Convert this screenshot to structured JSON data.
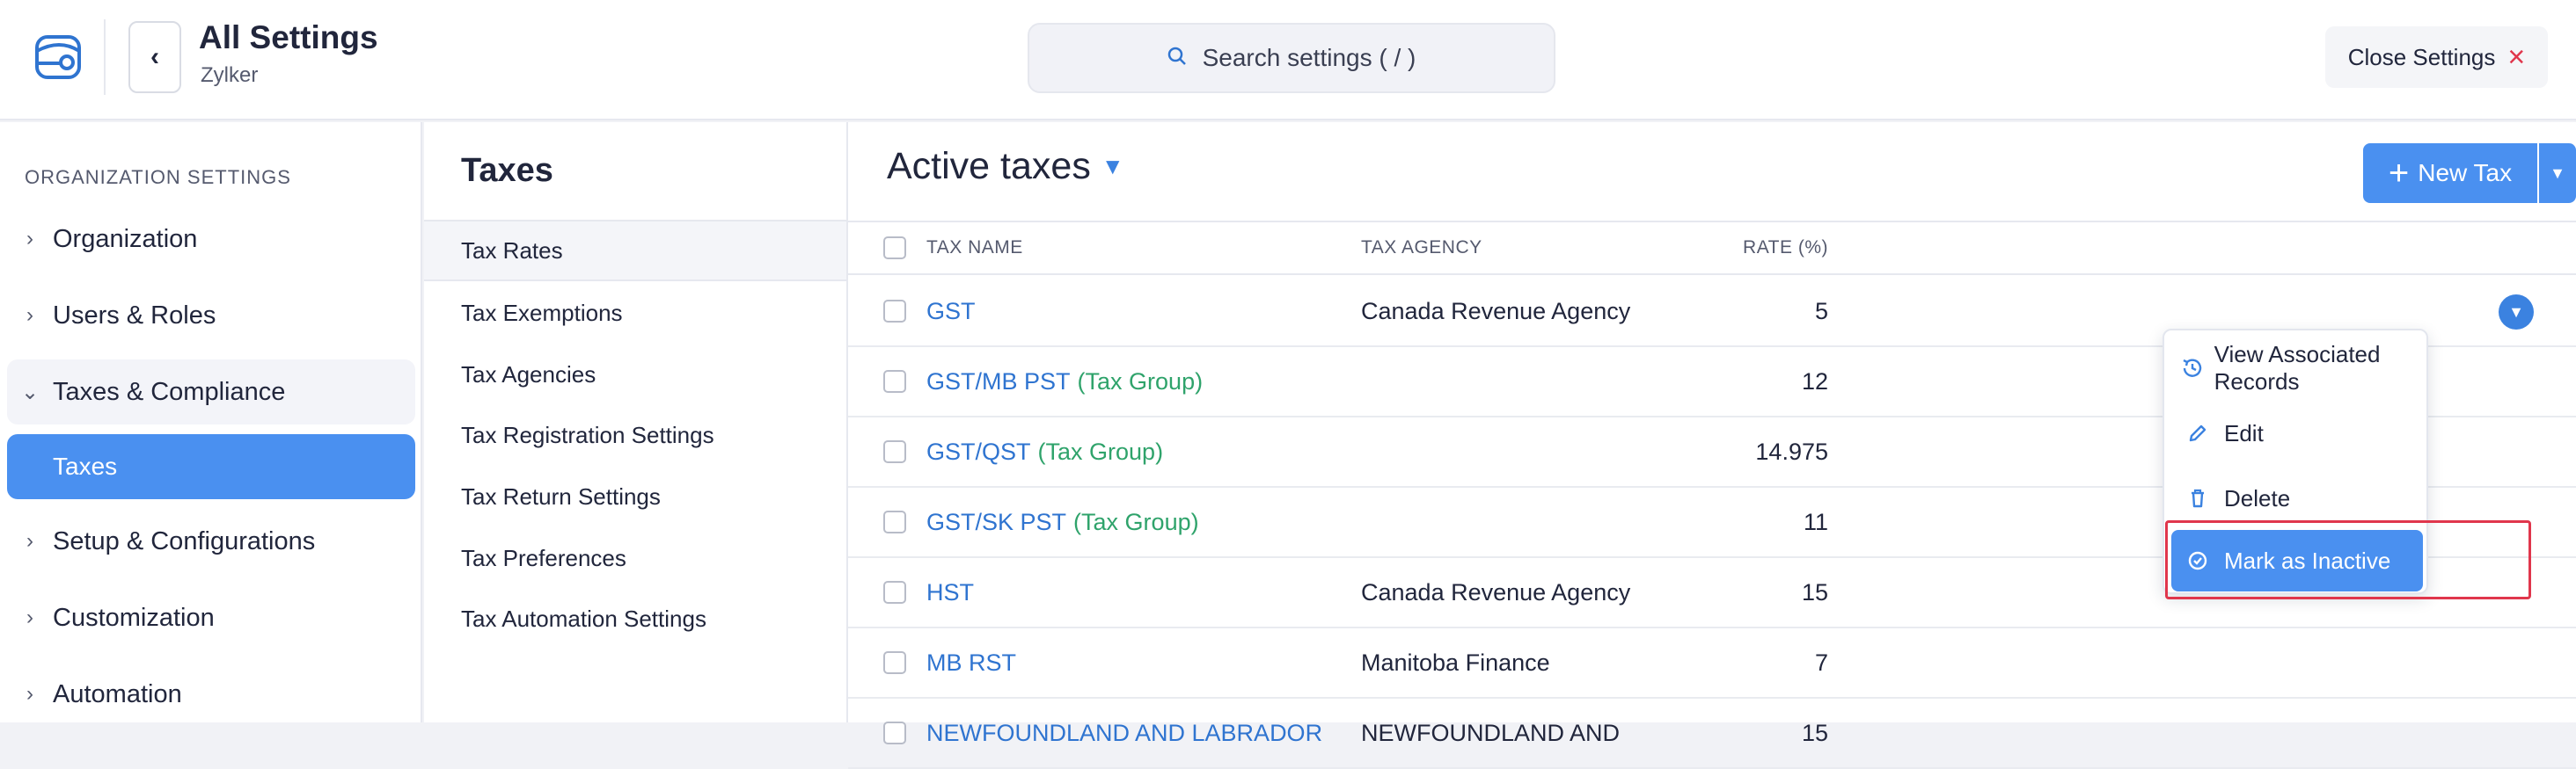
{
  "header": {
    "title": "All Settings",
    "org_name": "Zylker",
    "search_placeholder": "Search settings ( / )",
    "close_label": "Close Settings"
  },
  "leftnav": {
    "section_label": "ORGANIZATION SETTINGS",
    "items": [
      {
        "label": "Organization"
      },
      {
        "label": "Users & Roles"
      },
      {
        "label": "Taxes & Compliance"
      },
      {
        "label": "Taxes"
      },
      {
        "label": "Setup & Configurations"
      },
      {
        "label": "Customization"
      },
      {
        "label": "Automation"
      }
    ]
  },
  "subnav": {
    "title": "Taxes",
    "items": [
      {
        "label": "Tax Rates"
      },
      {
        "label": "Tax Exemptions"
      },
      {
        "label": "Tax Agencies"
      },
      {
        "label": "Tax Registration Settings"
      },
      {
        "label": "Tax Return Settings"
      },
      {
        "label": "Tax Preferences"
      },
      {
        "label": "Tax Automation Settings"
      }
    ]
  },
  "main": {
    "title": "Active taxes",
    "new_tax_label": "New Tax",
    "columns": {
      "tax_name": "TAX NAME",
      "tax_agency": "TAX AGENCY",
      "rate": "RATE (%)"
    },
    "rows": [
      {
        "name": "GST",
        "group": "",
        "agency": "Canada Revenue Agency",
        "rate": "5"
      },
      {
        "name": "GST/MB PST",
        "group": "(Tax Group)",
        "agency": "",
        "rate": "12"
      },
      {
        "name": "GST/QST",
        "group": "(Tax Group)",
        "agency": "",
        "rate": "14.975"
      },
      {
        "name": "GST/SK PST",
        "group": "(Tax Group)",
        "agency": "",
        "rate": "11"
      },
      {
        "name": "HST",
        "group": "",
        "agency": "Canada Revenue Agency",
        "rate": "15"
      },
      {
        "name": "MB RST",
        "group": "",
        "agency": "Manitoba Finance",
        "rate": "7"
      },
      {
        "name": "NEWFOUNDLAND AND LABRADOR",
        "group": "",
        "agency": "NEWFOUNDLAND AND",
        "rate": "15"
      }
    ]
  },
  "context_menu": {
    "items": [
      {
        "label": "View Associated Records"
      },
      {
        "label": "Edit"
      },
      {
        "label": "Delete"
      },
      {
        "label": "Mark as Inactive"
      }
    ]
  },
  "colors": {
    "accent": "#4a90f0",
    "link": "#2f74d0",
    "tax_group": "#2fa36b",
    "close_x": "#e0364c"
  }
}
